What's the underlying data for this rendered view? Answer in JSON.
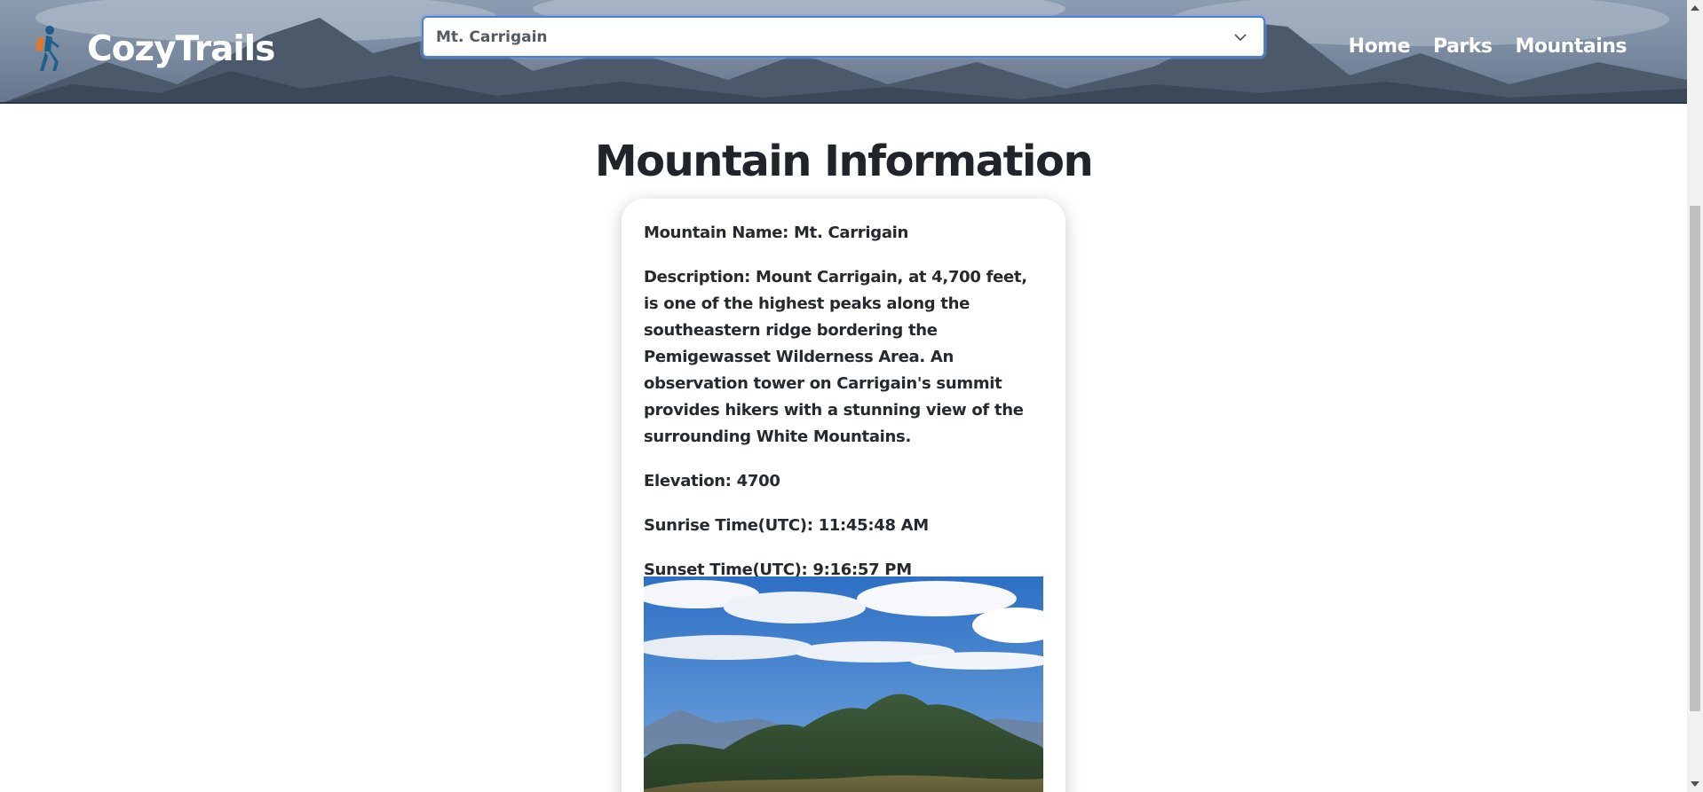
{
  "header": {
    "brand": "CozyTrails",
    "logo_icon": "hiker-icon",
    "mountain_select": {
      "selected": "Mt. Carrigain",
      "icon": "chevron-down-icon"
    },
    "nav": [
      {
        "label": "Home"
      },
      {
        "label": "Parks"
      },
      {
        "label": "Mountains"
      }
    ]
  },
  "main": {
    "title": "Mountain Information",
    "card": {
      "name_line": "Mountain Name: Mt. Carrigain",
      "description_line": "Description: Mount Carrigain, at 4,700 feet, is one of the highest peaks along the southeastern ridge bordering the Pemigewasset Wilderness Area. An observation tower on Carrigain's summit provides hikers with a stunning view of the surrounding White Mountains.",
      "elevation_line": "Elevation: 4700",
      "sunrise_line": "Sunrise Time(UTC): 11:45:48 AM",
      "sunset_line": "Sunset Time(UTC): 9:16:57 PM"
    }
  },
  "colors": {
    "header_accent": "#233a57",
    "select_border": "#4d7fd8",
    "hiker_blue": "#1f5f8b",
    "hiker_orange": "#e0792c"
  }
}
